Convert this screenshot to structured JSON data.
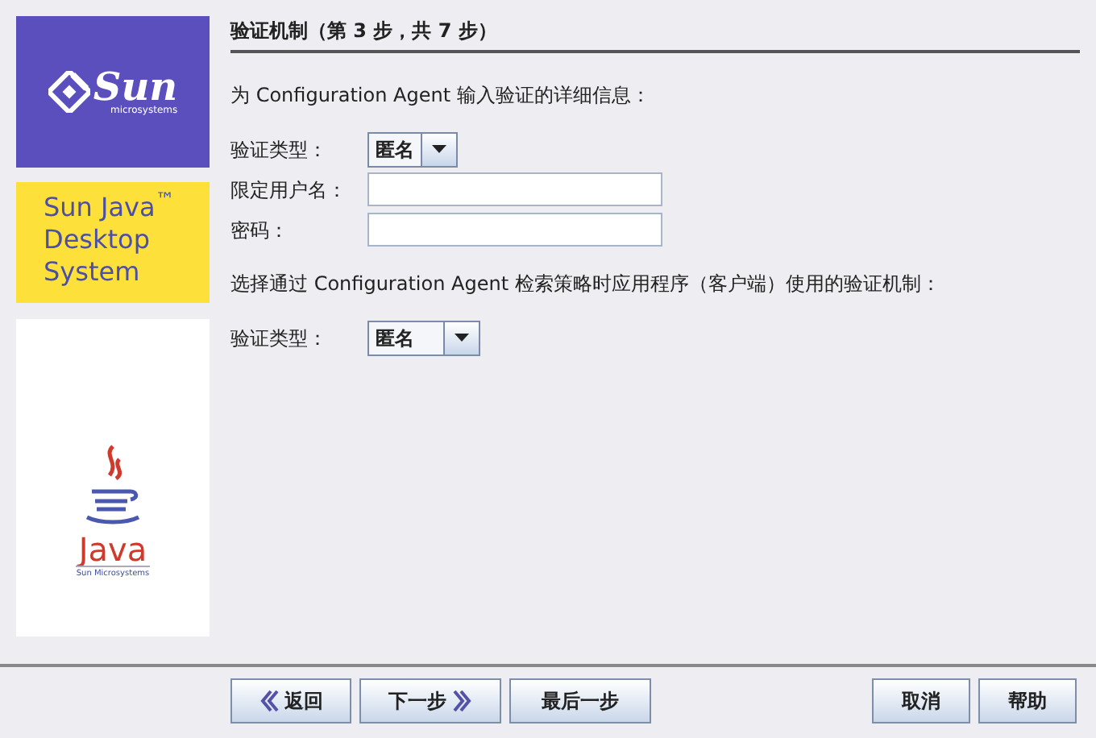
{
  "sidebar": {
    "sun_logo": {
      "wordmark": "Sun",
      "tagline": "microsystems"
    },
    "product_banner": {
      "lines": [
        "Sun Java$^{™}$",
        "Desktop",
        "System"
      ]
    },
    "java_logo": {
      "wordmark": "Java",
      "tagline": "Sun Microsystems"
    }
  },
  "step_title": "验证机制（第 3 步，共 7 步）",
  "sections": [
    {
      "intro": "为 Configuration Agent 输入验证的详细信息：",
      "fields": [
        {
          "kind": "combo",
          "label": "验证类型：",
          "value": "匿名"
        },
        {
          "kind": "text",
          "label": "限定用户名："
        },
        {
          "kind": "text",
          "label": "密码："
        }
      ]
    },
    {
      "intro": "选择通过 Configuration Agent 检索策略时应用程序（客户端）使用的验证机制：",
      "fields": [
        {
          "kind": "combo",
          "label": "验证类型：",
          "value": "匿名"
        }
      ]
    }
  ],
  "nav_buttons": [
    {
      "kind": "back",
      "label": "返回"
    },
    {
      "kind": "next",
      "label": "下一步"
    },
    {
      "kind": "plain",
      "label": "最后一步"
    }
  ],
  "action_buttons": [
    {
      "label": "取消"
    },
    {
      "label": "帮助"
    }
  ]
}
